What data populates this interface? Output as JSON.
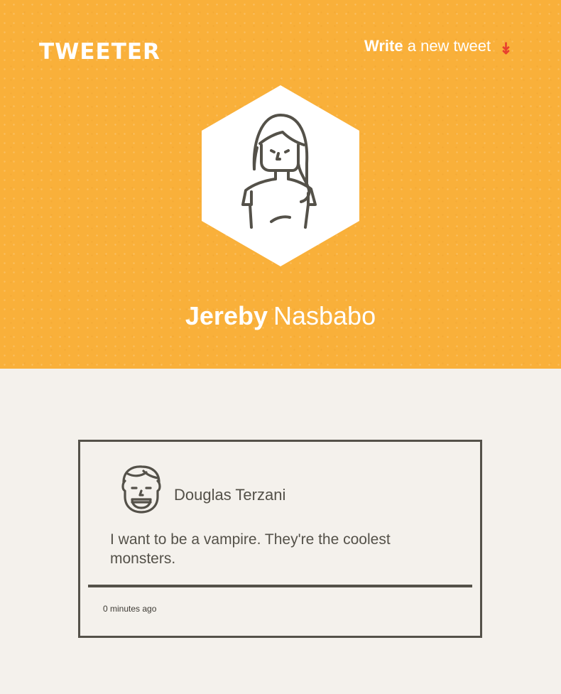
{
  "header": {
    "brand": "TWEETER",
    "compose_toggle": {
      "strong": "Write",
      "rest": "a new tweet",
      "icon": "arrow-down-icon",
      "icon_glyph": "↡",
      "icon_color": "#e8402e"
    },
    "background_color": "#f9b03a"
  },
  "profile": {
    "first_name": "Jereby",
    "last_name": "Nasbabo",
    "avatar_icon": "woman-avatar-icon"
  },
  "tweets": [
    {
      "author": "Douglas Terzani",
      "avatar_icon": "smiling-man-avatar-icon",
      "text": "I want to be a vampire. They're the coolest monsters.",
      "time": "0 minutes ago"
    }
  ],
  "colors": {
    "page_bg": "#f4f1ec",
    "ink": "#545149",
    "accent": "#e8402e"
  }
}
